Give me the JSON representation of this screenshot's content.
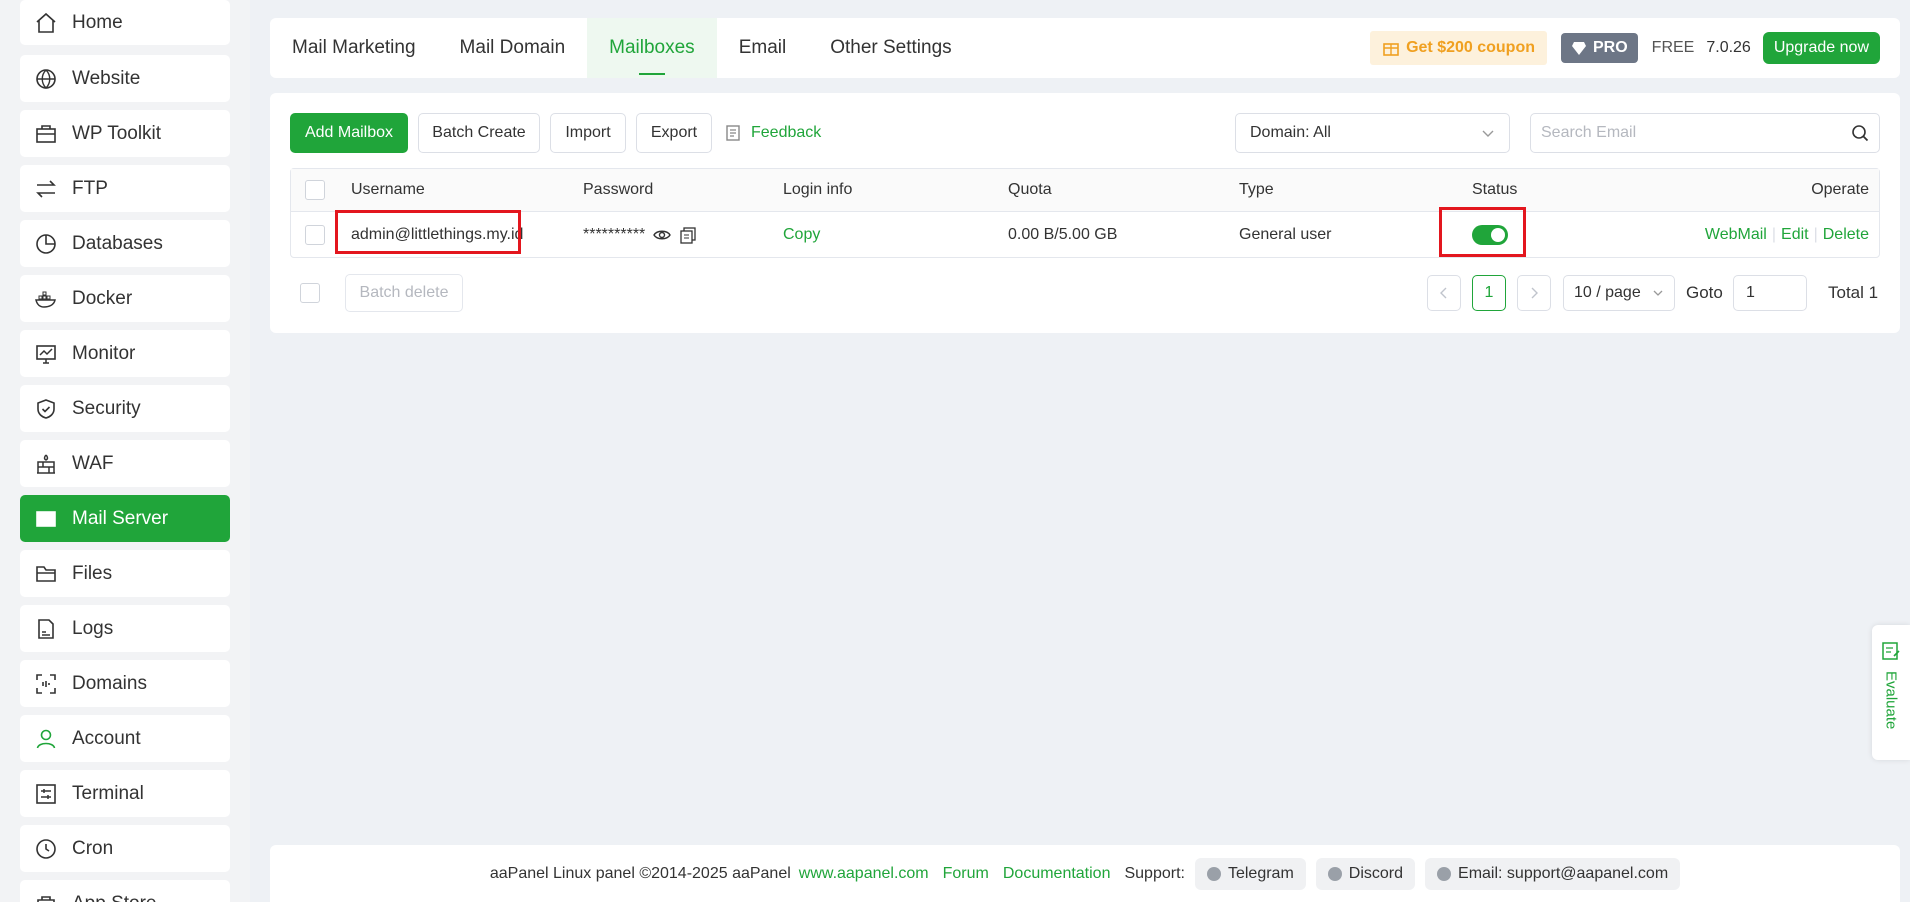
{
  "sidebar": {
    "items": [
      {
        "label": "Home",
        "icon": "home-icon"
      },
      {
        "label": "Website",
        "icon": "globe-icon"
      },
      {
        "label": "WP Toolkit",
        "icon": "toolbox-icon"
      },
      {
        "label": "FTP",
        "icon": "transfer-icon"
      },
      {
        "label": "Databases",
        "icon": "database-icon"
      },
      {
        "label": "Docker",
        "icon": "docker-icon"
      },
      {
        "label": "Monitor",
        "icon": "monitor-icon"
      },
      {
        "label": "Security",
        "icon": "shield-icon"
      },
      {
        "label": "WAF",
        "icon": "firewall-icon"
      },
      {
        "label": "Mail Server",
        "icon": "mail-icon",
        "active": true
      },
      {
        "label": "Files",
        "icon": "folder-icon"
      },
      {
        "label": "Logs",
        "icon": "log-icon"
      },
      {
        "label": "Domains",
        "icon": "domain-icon"
      },
      {
        "label": "Account",
        "icon": "user-icon"
      },
      {
        "label": "Terminal",
        "icon": "terminal-icon"
      },
      {
        "label": "Cron",
        "icon": "clock-icon"
      },
      {
        "label": "App Store",
        "icon": "store-icon"
      }
    ]
  },
  "tabs": [
    "Mail Marketing",
    "Mail Domain",
    "Mailboxes",
    "Email",
    "Other Settings"
  ],
  "active_tab": "Mailboxes",
  "top_right": {
    "coupon": "Get $200 coupon",
    "pro": "PRO",
    "free": "FREE",
    "version": "7.0.26",
    "upgrade": "Upgrade now"
  },
  "toolbar": {
    "add_mailbox": "Add Mailbox",
    "batch_create": "Batch Create",
    "import": "Import",
    "export": "Export",
    "feedback": "Feedback",
    "domain_select": "Domain: All",
    "search_placeholder": "Search Email"
  },
  "table": {
    "headers": {
      "username": "Username",
      "password": "Password",
      "login_info": "Login info",
      "quota": "Quota",
      "type": "Type",
      "status": "Status",
      "operate": "Operate"
    },
    "rows": [
      {
        "username": "admin@littlethings.my.id",
        "password": "**********",
        "login_info": "Copy",
        "quota": "0.00 B/5.00 GB",
        "type": "General user",
        "status_on": true,
        "ops": {
          "webmail": "WebMail",
          "edit": "Edit",
          "delete": "Delete"
        }
      }
    ]
  },
  "pagination": {
    "batch_delete": "Batch delete",
    "current_page": "1",
    "per_page": "10 / page",
    "goto_label": "Goto",
    "goto_value": "1",
    "total": "Total 1"
  },
  "footer": {
    "copyright": "aaPanel Linux panel ©2014-2025 aaPanel",
    "site": "www.aapanel.com",
    "forum": "Forum",
    "docs": "Documentation",
    "support": "Support:",
    "telegram": "Telegram",
    "discord": "Discord",
    "email": "Email: support@aapanel.com"
  },
  "evaluate": "Evaluate",
  "colors": {
    "accent": "#20a53a",
    "highlight": "#e3161e",
    "coupon_bg": "#fdf1dc",
    "coupon_text": "#f0a020"
  }
}
